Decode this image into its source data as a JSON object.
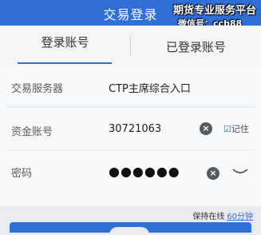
{
  "header": {
    "title": "交易登录",
    "watermark_line1": "期货专业服务平台",
    "watermark_line2": "微信号：ccb88"
  },
  "tabs": [
    {
      "label": "登录账号",
      "selected": true
    },
    {
      "label": "已登录账号",
      "selected": false
    }
  ],
  "form": {
    "server_label": "交易服务器",
    "server_value": "CTP主席综合入口",
    "account_label": "资金账号",
    "account_value": "30721063",
    "password_label": "密码",
    "password_mask": "●●●●●●",
    "remember_label": "记住",
    "remember_checked": true
  },
  "footer": {
    "online_label": "保持在线",
    "online_duration": "60分钟"
  },
  "colors": {
    "accent": "#2f6fd6",
    "background": "#e9ebef"
  },
  "icons": {
    "clear": "close-circle-icon",
    "remember": "checkbox-checked-icon",
    "password_visibility": "eye-closed-icon"
  }
}
